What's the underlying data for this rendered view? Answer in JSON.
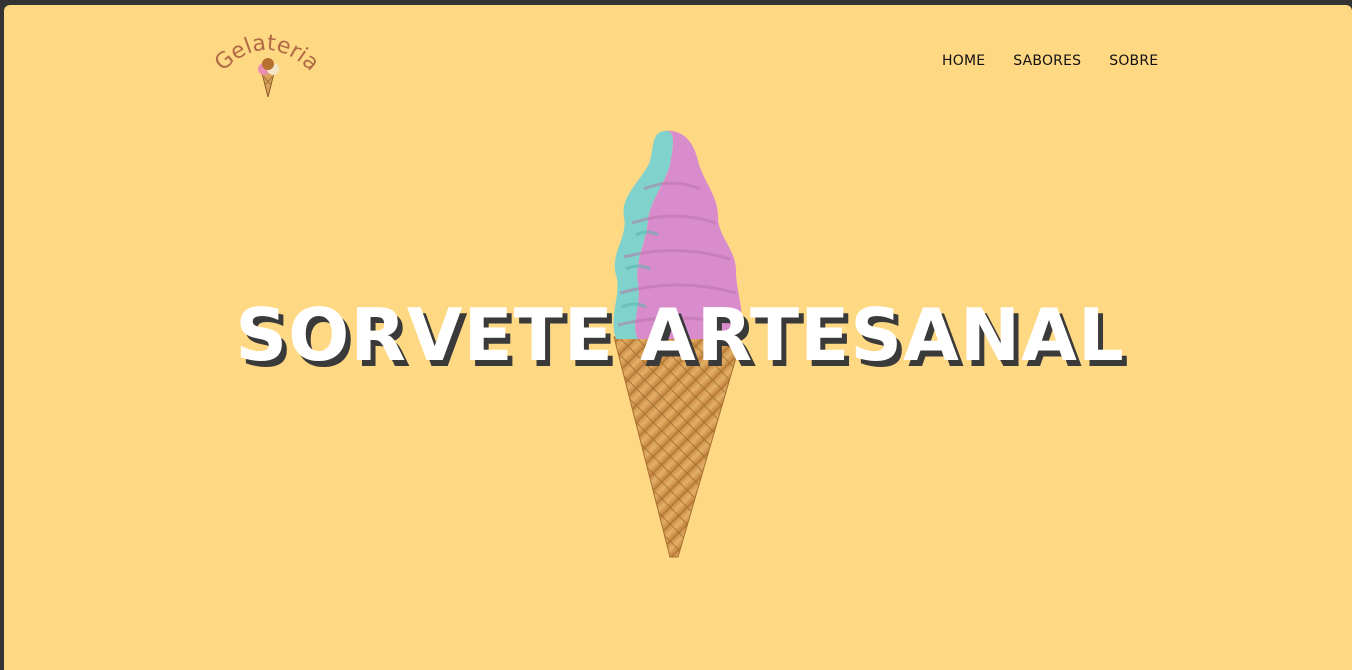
{
  "header": {
    "logo_text": "Gelateria"
  },
  "nav": {
    "items": [
      {
        "label": "HOME"
      },
      {
        "label": "SABORES"
      },
      {
        "label": "SOBRE"
      }
    ]
  },
  "hero": {
    "title": "SORVETE ARTESANAL"
  },
  "colors": {
    "background": "#FFD884",
    "frame": "#333333",
    "logo": "#B06A45",
    "title": "#FFFFFF",
    "title_shadow": "#3a3a3a",
    "ice_cream_pink": "#D98CCB",
    "ice_cream_teal": "#7FD3CC",
    "cone": "#D9A25A"
  }
}
